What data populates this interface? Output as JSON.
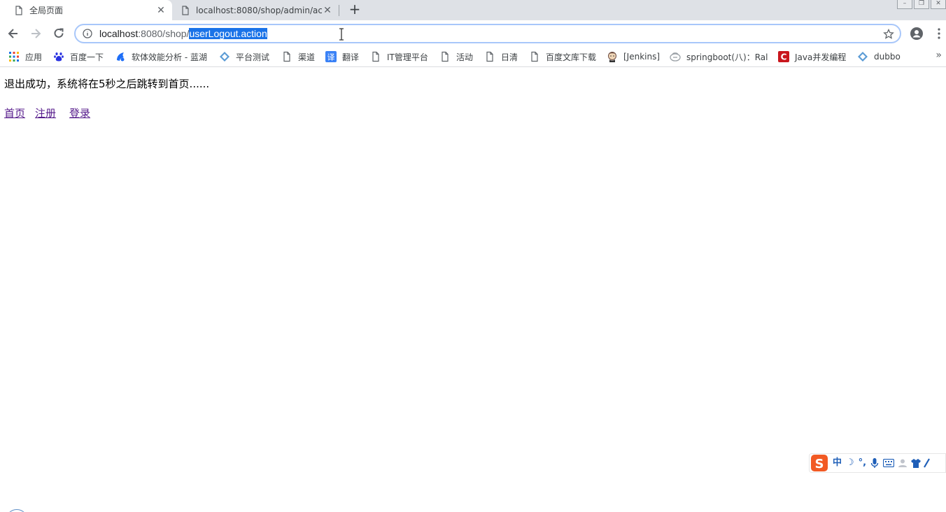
{
  "tabs": [
    {
      "title": "全局页面",
      "active": true
    },
    {
      "title": "localhost:8080/shop/admin/ac",
      "active": false
    }
  ],
  "address_bar": {
    "host": "localhost",
    "port_path": ":8080/shop/",
    "selected": "userLogout.action"
  },
  "bookmarks": [
    {
      "label": "应用",
      "icon": "apps-grid-icon"
    },
    {
      "label": "百度一下",
      "icon": "baidu-paw-icon"
    },
    {
      "label": "软体效能分析 - 蓝湖",
      "icon": "lanhu-icon"
    },
    {
      "label": "平台测试",
      "icon": "diamond-icon"
    },
    {
      "label": "渠道",
      "icon": "page-icon"
    },
    {
      "label": "翻译",
      "icon": "translate-icon"
    },
    {
      "label": "IT管理平台",
      "icon": "page-icon"
    },
    {
      "label": "活动",
      "icon": "page-icon"
    },
    {
      "label": "日清",
      "icon": "page-icon"
    },
    {
      "label": "百度文库下载",
      "icon": "page-icon"
    },
    {
      "label": "[Jenkins]",
      "icon": "jenkins-icon"
    },
    {
      "label": "springboot(八)：Ral",
      "icon": "spring-icon"
    },
    {
      "label": "Java并发编程",
      "icon": "csdn-icon"
    },
    {
      "label": "dubbo",
      "icon": "diamond-icon"
    }
  ],
  "page": {
    "message": "退出成功，系统将在5秒之后跳转到首页......",
    "links": [
      "首页",
      "注册",
      "登录"
    ]
  },
  "ime": {
    "mode": "中"
  },
  "colors": {
    "selection": "#1a73e8",
    "visited_link": "#551a8b",
    "focus_ring": "#a8c7fa"
  }
}
